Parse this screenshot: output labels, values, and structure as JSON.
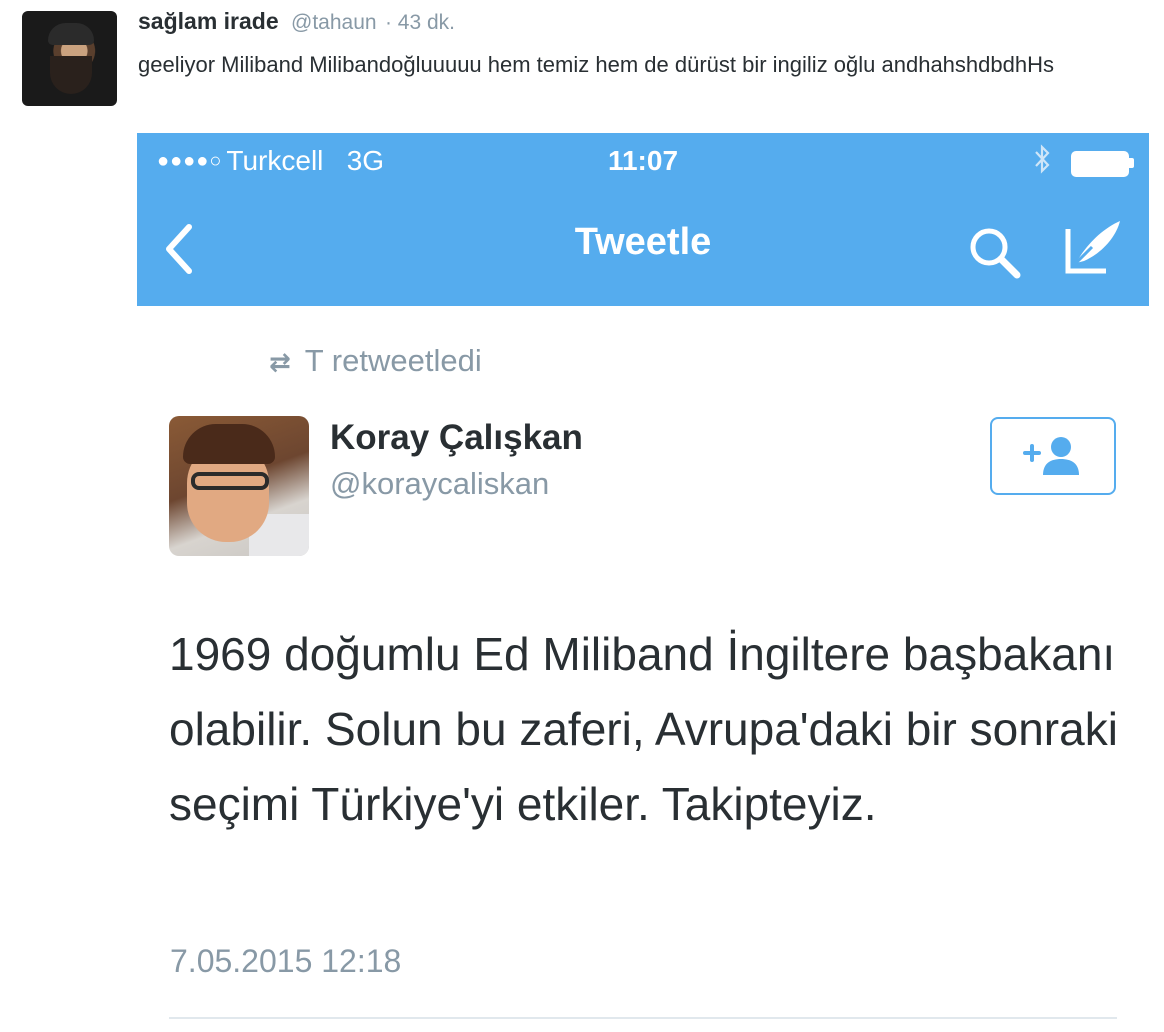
{
  "outer_tweet": {
    "display_name": "sağlam irade",
    "handle": "@tahaun",
    "time": "· 43 dk.",
    "text": "geeliyor Miliband Milibandoğluuuuu hem temiz hem de dürüst bir ingiliz oğlu andhahshdbdhHs"
  },
  "phone": {
    "status_bar": {
      "signal": "●●●●○",
      "carrier": "Turkcell",
      "network": "3G",
      "time": "11:07",
      "bluetooth_icon": "bluetooth-icon",
      "battery_icon": "battery-icon"
    },
    "nav": {
      "back_icon": "‹",
      "title": "Tweetle",
      "search_icon": "search-icon",
      "compose_icon": "compose-icon"
    },
    "retweet": {
      "icon": "⇄",
      "text": "T retweetledi"
    },
    "author": {
      "name": "Koray Çalışkan",
      "handle": "@koraycaliskan"
    },
    "follow_button_icon": "add-user-icon",
    "tweet_text": "1969 doğumlu Ed Miliband İngiltere başbakanı olabilir. Solun bu zaferi, Avrupa'daki bir sonraki seçimi Türkiye'yi etkiler. Takipteyiz.",
    "date": "7.05.2015 12:18"
  },
  "colors": {
    "twitter_blue": "#55acee",
    "text_dark": "#292f33",
    "text_gray": "#8899a6"
  }
}
